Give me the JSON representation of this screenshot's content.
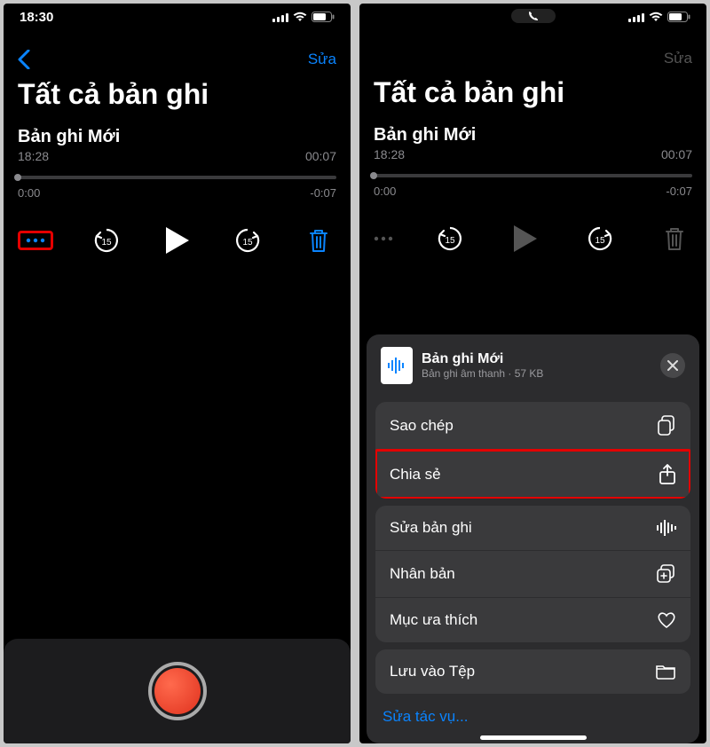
{
  "left": {
    "status": {
      "time": "18:30"
    },
    "nav": {
      "edit": "Sửa"
    },
    "title": "Tất cả bản ghi",
    "recording": {
      "name": "Bản ghi Mới",
      "time": "18:28",
      "duration": "00:07",
      "scrub_start": "0:00",
      "scrub_end": "-0:07"
    }
  },
  "right": {
    "nav": {
      "edit": "Sửa"
    },
    "title": "Tất cả bản ghi",
    "recording": {
      "name": "Bản ghi Mới",
      "time": "18:28",
      "duration": "00:07",
      "scrub_start": "0:00",
      "scrub_end": "-0:07"
    },
    "sheet": {
      "file_name": "Bản ghi Mới",
      "file_sub": "Bản ghi âm thanh · 57 KB",
      "copy": "Sao chép",
      "share": "Chia sẻ",
      "edit_recording": "Sửa bản ghi",
      "duplicate": "Nhân bản",
      "favorite": "Mục ưa thích",
      "save_to_files": "Lưu vào Tệp",
      "edit_actions": "Sửa tác vụ..."
    }
  }
}
